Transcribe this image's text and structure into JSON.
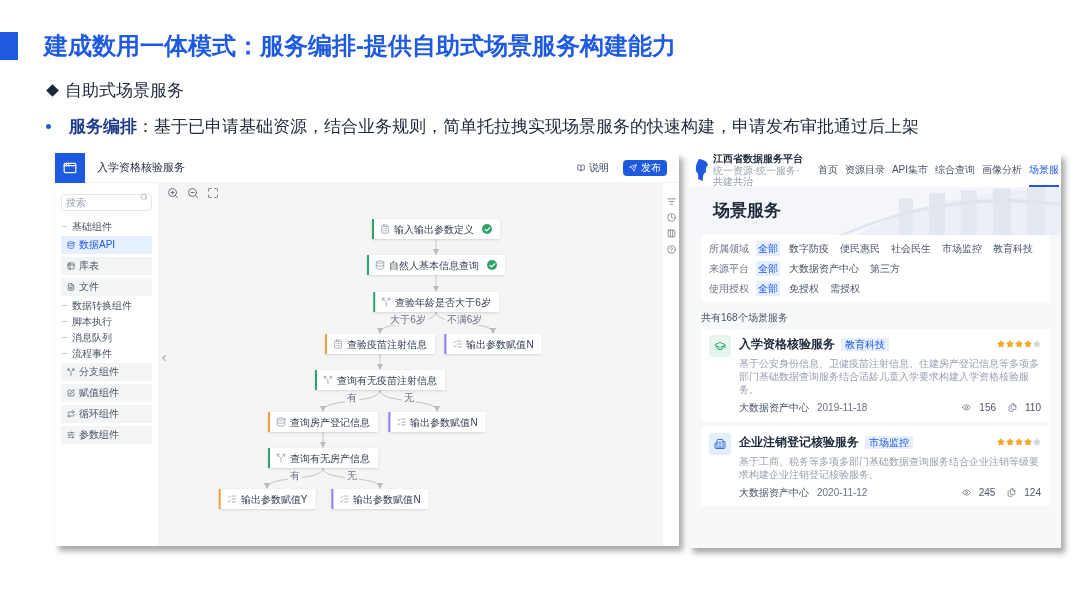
{
  "slide": {
    "title": "建成数用一体模式：服务编排-提供自助式场景服务构建能力",
    "heading": "自助式场景服务",
    "bullets": [
      "**服务编排**：基于已申请基础资源，结合业务规则，简单托拉拽实现场景服务的快速构建，申请发布审批通过后上架"
    ]
  },
  "editor": {
    "title": "入学资格核验服务",
    "buttons": [
      {
        "label": "说明",
        "kind": "secondary"
      },
      {
        "label": "发布",
        "kind": "primary"
      }
    ],
    "search": {
      "placeholder": "搜索"
    },
    "sidebar": [
      {
        "label": "基础组件",
        "children": [
          {
            "label": "数据API",
            "selected": true
          },
          {
            "label": "库表",
            "selected": false
          },
          {
            "label": "文件",
            "selected": false
          }
        ]
      },
      {
        "label": "数据转换组件"
      },
      {
        "label": "脚本执行"
      },
      {
        "label": "消息队列"
      },
      {
        "label": "流程事件",
        "children": [
          {
            "label": "分支组件",
            "selected": false
          },
          {
            "label": "赋值组件",
            "selected": false
          },
          {
            "label": "循环组件",
            "selected": false
          },
          {
            "label": "参数组件",
            "selected": false
          }
        ]
      }
    ],
    "flow": {
      "label": "输入输出参数定义",
      "kind": "form",
      "color": "#2fa36b",
      "done": true,
      "children": [
        {
          "label": "自然人基本信息查询",
          "kind": "database",
          "color": "#2fa36b",
          "done": true,
          "children": [
            {
              "label": "查验年龄是否大于6岁",
              "kind": "branch",
              "color": "#2fa36b",
              "done": false,
              "children": [
                {
                  "edge_label": "大于6岁",
                  "label": "查验疫苗注射信息",
                  "kind": "form",
                  "color": "#f0a040",
                  "done": false,
                  "children": [
                    {
                      "label": "查询有无疫苗注射信息",
                      "kind": "branch",
                      "color": "#2fa36b",
                      "done": false,
                      "children": [
                        {
                          "edge_label": "有",
                          "label": "查询房产登记信息",
                          "kind": "database",
                          "color": "#f0a040",
                          "done": false,
                          "children": [
                            {
                              "label": "查询有无房产信息",
                              "kind": "branch",
                              "color": "#2fa36b",
                              "done": false,
                              "children": [
                                {
                                  "edge_label": "有",
                                  "label": "输出参数赋值Y",
                                  "kind": "output",
                                  "color": "#f0a040",
                                  "done": false
                                },
                                {
                                  "edge_label": "无",
                                  "label": "输出参数赋值N",
                                  "kind": "output",
                                  "color": "#8b7cf0",
                                  "done": false
                                }
                              ]
                            }
                          ]
                        },
                        {
                          "edge_label": "无",
                          "label": "输出参数赋值N",
                          "kind": "output",
                          "color": "#8b7cf0",
                          "done": false
                        }
                      ]
                    }
                  ]
                },
                {
                  "edge_label": "不满6岁",
                  "label": "输出参数赋值N",
                  "kind": "output",
                  "color": "#8b7cf0",
                  "done": false
                }
              ]
            }
          ]
        }
      ]
    }
  },
  "portal": {
    "site_title": "江西省数据服务平台",
    "site_subtitle": "统一资源·统一服务·共建共治",
    "nav": [
      {
        "label": "首页",
        "selected": false
      },
      {
        "label": "资源目录",
        "selected": false
      },
      {
        "label": "API集市",
        "selected": false
      },
      {
        "label": "综合查询",
        "selected": false
      },
      {
        "label": "画像分析",
        "selected": false
      },
      {
        "label": "场景服",
        "selected": true
      }
    ],
    "page_title": "场景服务",
    "filters": [
      {
        "label": "所属领域",
        "options": [
          {
            "label": "全部",
            "selected": true
          },
          {
            "label": "数字防疫",
            "selected": false
          },
          {
            "label": "便民惠民",
            "selected": false
          },
          {
            "label": "社会民生",
            "selected": false
          },
          {
            "label": "市场监控",
            "selected": false
          },
          {
            "label": "教育科技",
            "selected": false
          }
        ]
      },
      {
        "label": "来源平台",
        "options": [
          {
            "label": "全部",
            "selected": true
          },
          {
            "label": "大数据资产中心",
            "selected": false
          },
          {
            "label": "第三方",
            "selected": false
          }
        ]
      },
      {
        "label": "使用授权",
        "options": [
          {
            "label": "全部",
            "selected": true
          },
          {
            "label": "免授权",
            "selected": false
          },
          {
            "label": "需授权",
            "selected": false
          }
        ]
      }
    ],
    "count": "共有168个场景服务",
    "cards": [
      {
        "kind": "education",
        "title": "入学资格核验服务",
        "tag": "教育科技",
        "stars": 4,
        "description": "基于公安身份信息、卫健疫苗注射信息、住建房产登记信息等多项多部门基础数据查询服务结合适龄儿童入学要求构建入学资格核验服务。",
        "source": "大数据资产中心",
        "date": "2019-11-18",
        "views": "156",
        "uses": "110"
      },
      {
        "kind": "enterprise",
        "title": "企业注销登记核验服务",
        "tag": "市场监控",
        "stars": 4,
        "description": "基于工商、税务等多项多部门基础数据查询服务结合企业注销等级要求构建企业注销登记核验服务。",
        "source": "大数据资产中心",
        "date": "2020-11-12",
        "views": "245",
        "uses": "124"
      }
    ]
  }
}
